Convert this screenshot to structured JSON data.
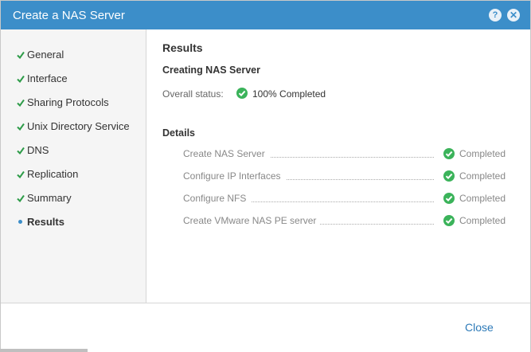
{
  "window": {
    "title": "Create a NAS Server",
    "help_label": "?",
    "close_label": "✕"
  },
  "sidebar": {
    "steps": [
      {
        "label": "General",
        "state": "done"
      },
      {
        "label": "Interface",
        "state": "done"
      },
      {
        "label": "Sharing Protocols",
        "state": "done"
      },
      {
        "label": "Unix Directory Service",
        "state": "done"
      },
      {
        "label": "DNS",
        "state": "done"
      },
      {
        "label": "Replication",
        "state": "done"
      },
      {
        "label": "Summary",
        "state": "done"
      },
      {
        "label": "Results",
        "state": "current"
      }
    ]
  },
  "main": {
    "heading": "Results",
    "subheading": "Creating NAS Server",
    "overall_label": "Overall status:",
    "overall_value": "100% Completed",
    "details_heading": "Details",
    "tasks": [
      {
        "name": "Create NAS Server",
        "status": "Completed"
      },
      {
        "name": "Configure IP Interfaces",
        "status": "Completed"
      },
      {
        "name": "Configure NFS",
        "status": "Completed"
      },
      {
        "name": "Create VMware NAS PE server",
        "status": "Completed"
      }
    ]
  },
  "footer": {
    "close_label": "Close"
  },
  "colors": {
    "accent": "#3c8ec9",
    "success": "#3bb35a",
    "link": "#2d7ab8"
  }
}
